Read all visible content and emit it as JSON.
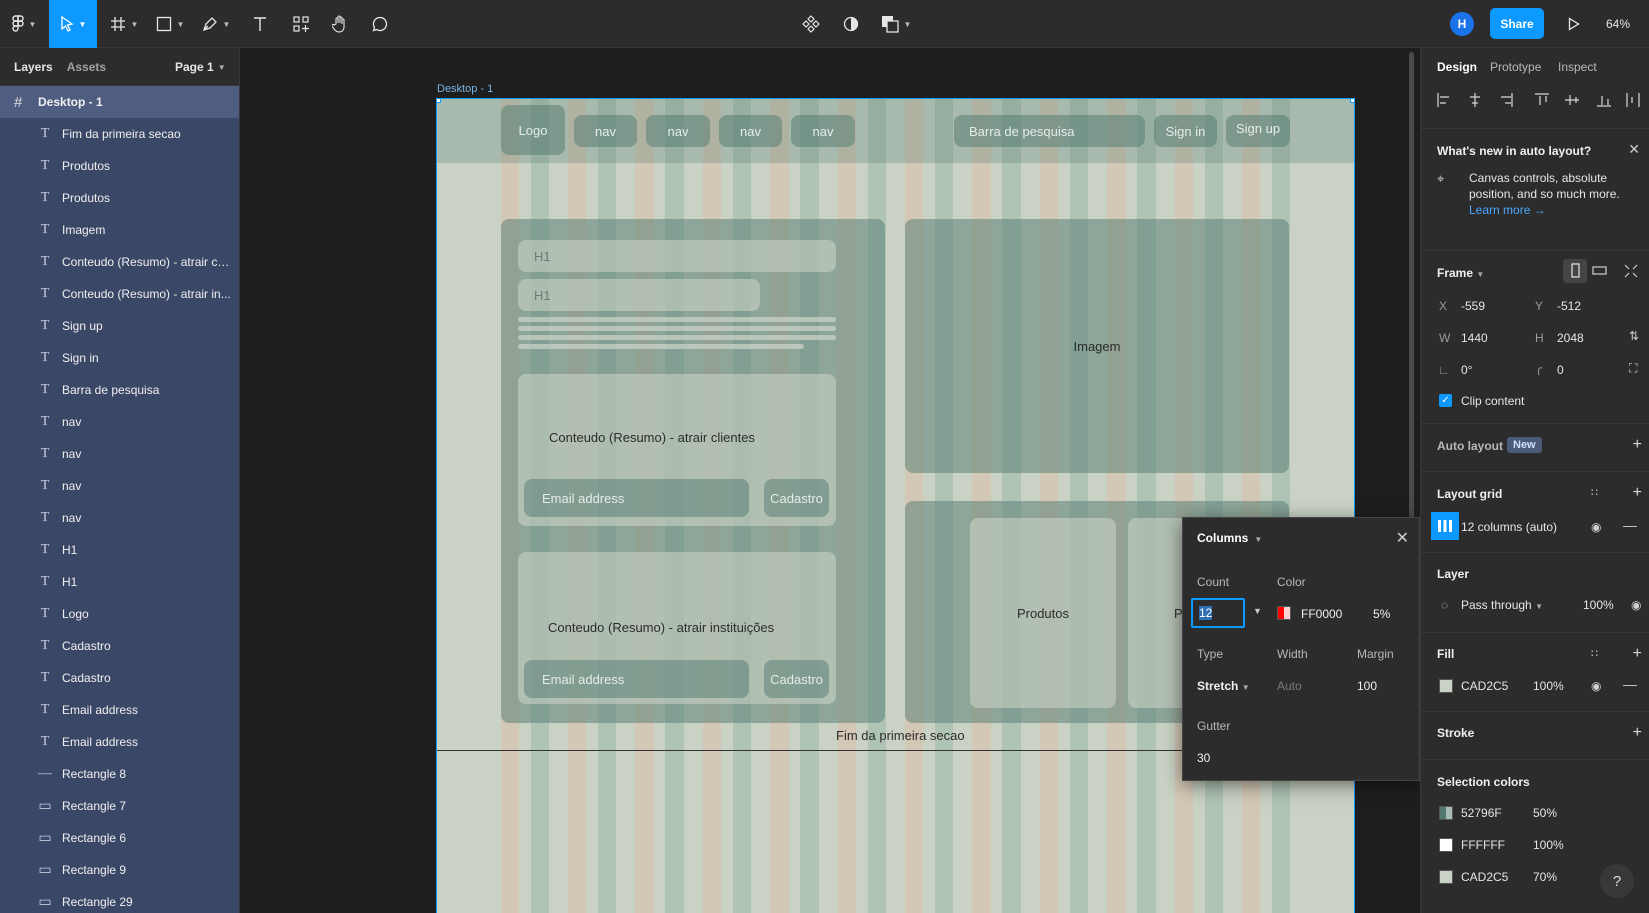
{
  "toolbar": {
    "share_label": "Share",
    "avatar_initial": "H",
    "zoom": "64%"
  },
  "left_panel": {
    "tabs": [
      "Layers",
      "Assets"
    ],
    "page": "Page 1",
    "top_layer": "Desktop - 1",
    "layers": [
      {
        "name": "Fim da primeira secao",
        "icon": "text"
      },
      {
        "name": "Produtos",
        "icon": "text"
      },
      {
        "name": "Produtos",
        "icon": "text"
      },
      {
        "name": "Imagem",
        "icon": "text"
      },
      {
        "name": "Conteudo (Resumo) - atrair cli...",
        "icon": "text"
      },
      {
        "name": "Conteudo (Resumo) - atrair in...",
        "icon": "text"
      },
      {
        "name": "Sign up",
        "icon": "text"
      },
      {
        "name": "Sign in",
        "icon": "text"
      },
      {
        "name": "Barra de pesquisa",
        "icon": "text"
      },
      {
        "name": "nav",
        "icon": "text"
      },
      {
        "name": "nav",
        "icon": "text"
      },
      {
        "name": "nav",
        "icon": "text"
      },
      {
        "name": "nav",
        "icon": "text"
      },
      {
        "name": "H1",
        "icon": "text"
      },
      {
        "name": "H1",
        "icon": "text"
      },
      {
        "name": "Logo",
        "icon": "text"
      },
      {
        "name": "Cadastro",
        "icon": "text"
      },
      {
        "name": "Cadastro",
        "icon": "text"
      },
      {
        "name": "Email address",
        "icon": "text"
      },
      {
        "name": "Email address",
        "icon": "text"
      },
      {
        "name": "Rectangle 8",
        "icon": "line"
      },
      {
        "name": "Rectangle 7",
        "icon": "rect"
      },
      {
        "name": "Rectangle 6",
        "icon": "rect"
      },
      {
        "name": "Rectangle 9",
        "icon": "rect"
      },
      {
        "name": "Rectangle 29",
        "icon": "rect"
      }
    ]
  },
  "canvas": {
    "frame_label": "Desktop - 1",
    "header": {
      "logo": "Logo",
      "nav": [
        "nav",
        "nav",
        "nav",
        "nav"
      ],
      "search": "Barra de pesquisa",
      "sign_in": "Sign in",
      "sign_up": "Sign up"
    },
    "h1_a": "H1",
    "h1_b": "H1",
    "content_clients": "Conteudo (Resumo) - atrair clientes",
    "content_institutions": "Conteudo (Resumo) - atrair instituições",
    "email_placeholder": "Email address",
    "cadastro": "Cadastro",
    "image": "Imagem",
    "produtos": "Produtos",
    "produtos_partial": "P",
    "section_end": "Fim da primeira secao"
  },
  "grid_popover": {
    "title": "Columns",
    "count_label": "Count",
    "count_value": "12",
    "color_label": "Color",
    "color_hex": "FF0000",
    "color_opacity": "5%",
    "type_label": "Type",
    "type_value": "Stretch",
    "width_label": "Width",
    "width_value": "Auto",
    "margin_label": "Margin",
    "margin_value": "100",
    "gutter_label": "Gutter",
    "gutter_value": "30"
  },
  "right_panel": {
    "tabs": [
      "Design",
      "Prototype",
      "Inspect"
    ],
    "whats_new": {
      "title": "What's new in auto layout?",
      "body_1": "Canvas controls, absolute",
      "body_2": "position, and so much more.",
      "link": "Learn more →"
    },
    "frame": {
      "label": "Frame",
      "x_label": "X",
      "x": "-559",
      "y_label": "Y",
      "y": "-512",
      "w_label": "W",
      "w": "1440",
      "h_label": "H",
      "h": "2048",
      "rotation": "0°",
      "radius": "0",
      "clip_content": "Clip content"
    },
    "auto_layout": {
      "label": "Auto layout",
      "badge": "New"
    },
    "layout_grid": {
      "label": "Layout grid",
      "item": "12 columns (auto)"
    },
    "layer": {
      "label": "Layer",
      "blend": "Pass through",
      "opacity": "100%"
    },
    "fill": {
      "label": "Fill",
      "hex": "CAD2C5",
      "opacity": "100%",
      "swatch_color": "#CAD2C5"
    },
    "stroke": {
      "label": "Stroke"
    },
    "selection_colors": {
      "label": "Selection colors",
      "items": [
        {
          "hex": "52796F",
          "opacity": "50%",
          "color": "#52796F"
        },
        {
          "hex": "FFFFFF",
          "opacity": "100%",
          "color": "#FFFFFF"
        },
        {
          "hex": "CAD2C5",
          "opacity": "70%",
          "color": "#CAD2C5"
        }
      ]
    },
    "help": "?"
  },
  "colors": {
    "accent": "#0d99ff",
    "frame_fill": "#CAD2C5",
    "block_fill": "#52796F",
    "grid_red": "#FF0000"
  }
}
